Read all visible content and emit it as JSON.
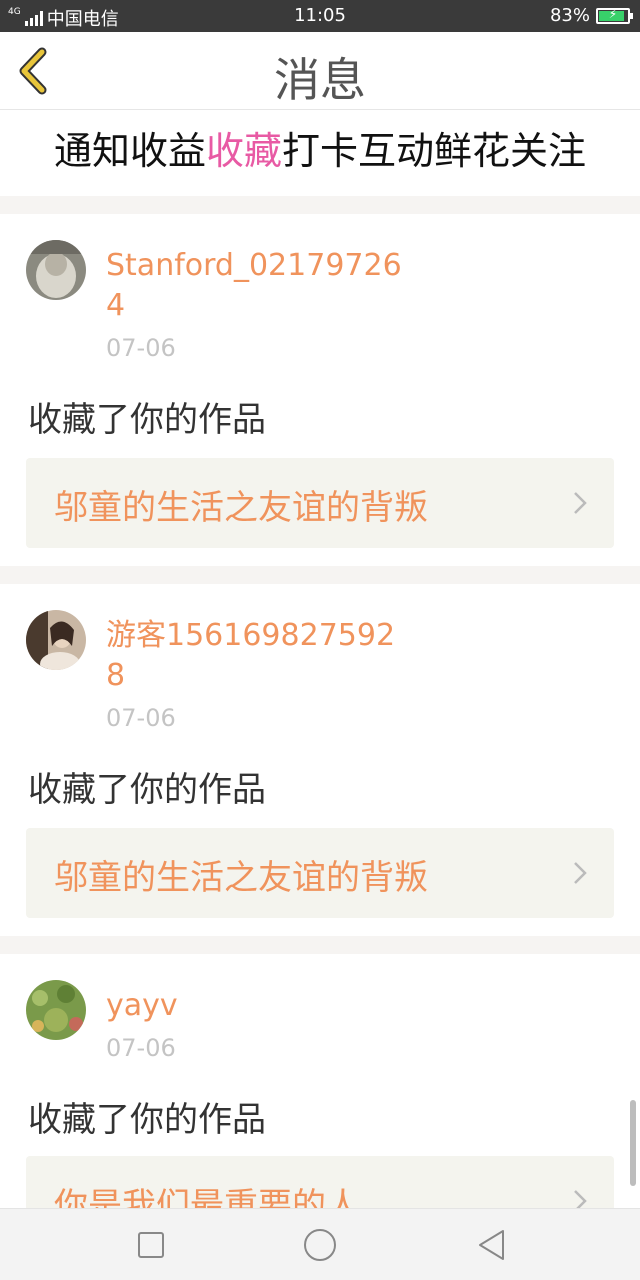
{
  "status_bar": {
    "network_tag": "4G",
    "carrier": "中国电信",
    "time": "11:05",
    "battery_percent": "83%",
    "battery_level": 0.83,
    "battery_color": "#38d16a"
  },
  "header": {
    "title": "消息",
    "back_icon": "chevron-left-icon",
    "accent_color": "#e8c53a"
  },
  "tabs": [
    {
      "label": "通知",
      "active": false
    },
    {
      "label": "收益",
      "active": false
    },
    {
      "label": "收藏",
      "active": true
    },
    {
      "label": "打卡",
      "active": false
    },
    {
      "label": "互动",
      "active": false
    },
    {
      "label": "鲜花",
      "active": false
    },
    {
      "label": "关注",
      "active": false
    }
  ],
  "active_tab_color": "#e85aa4",
  "items": [
    {
      "username": "Stanford_021797264",
      "date": "07-06",
      "action": "收藏了你的作品",
      "work_title": "邬童的生活之友谊的背叛"
    },
    {
      "username": "游客1561698275928",
      "date": "07-06",
      "action": "收藏了你的作品",
      "work_title": "邬童的生活之友谊的背叛"
    },
    {
      "username": "yayv",
      "date": "07-06",
      "action": "收藏了你的作品",
      "work_title": "你是我们最重要的人"
    }
  ],
  "username_color": "#f0935c",
  "nav_bar": {
    "icons": [
      "square-icon",
      "circle-icon",
      "triangle-back-icon"
    ]
  }
}
